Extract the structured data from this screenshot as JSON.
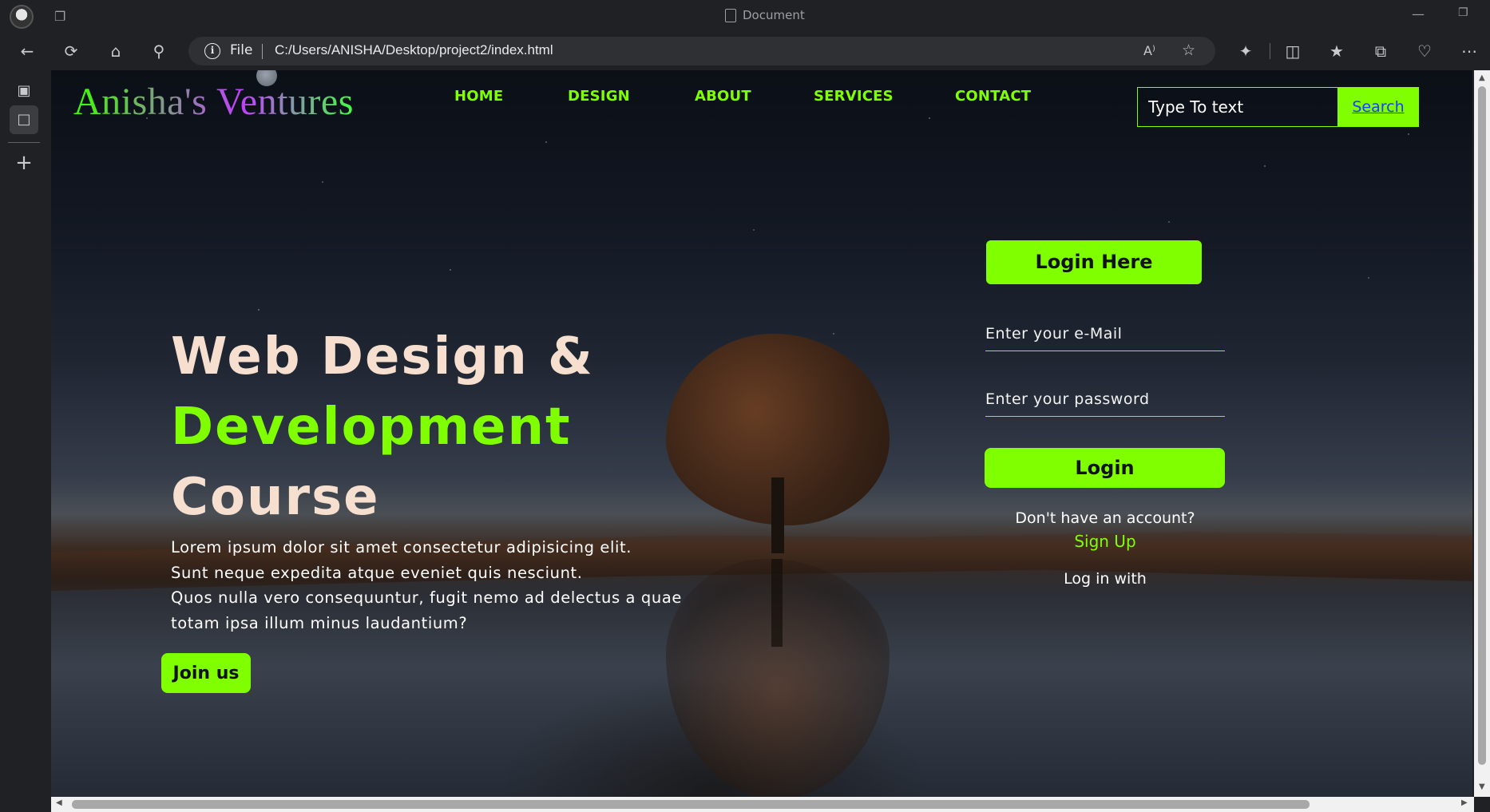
{
  "browser": {
    "tab_title": "Document",
    "url_scheme_label": "File",
    "url": "C:/Users/ANISHA/Desktop/project2/index.html",
    "read_aloud_icon": "A⁾"
  },
  "site": {
    "logo": "Anisha's Ventures",
    "nav": [
      {
        "label": "HOME"
      },
      {
        "label": "DESIGN"
      },
      {
        "label": "ABOUT"
      },
      {
        "label": "SERVICES"
      },
      {
        "label": "CONTACT"
      }
    ],
    "search": {
      "placeholder": "Type To text",
      "button_label": "Search"
    }
  },
  "hero": {
    "line1": "Web Design &",
    "line2": "Development",
    "line3": "Course",
    "paragraph_lines": [
      "Lorem ipsum dolor sit amet consectetur adipisicing elit.",
      "Sunt neque expedita atque eveniet quis nesciunt.",
      "Quos nulla vero consequuntur, fugit nemo ad delectus a quae",
      "totam ipsa illum minus laudantium?"
    ],
    "cta_label": "Join us"
  },
  "login": {
    "title": "Login Here",
    "email_placeholder": "Enter your e-Mail",
    "password_placeholder": "Enter your password",
    "button_label": "Login",
    "no_account_text": "Don't have an account?",
    "signup_label": "Sign Up",
    "login_with_text": "Log in with"
  },
  "colors": {
    "accent": "#7fff00",
    "hero_text": "#f6dfcf",
    "chrome_bg": "#202124"
  }
}
